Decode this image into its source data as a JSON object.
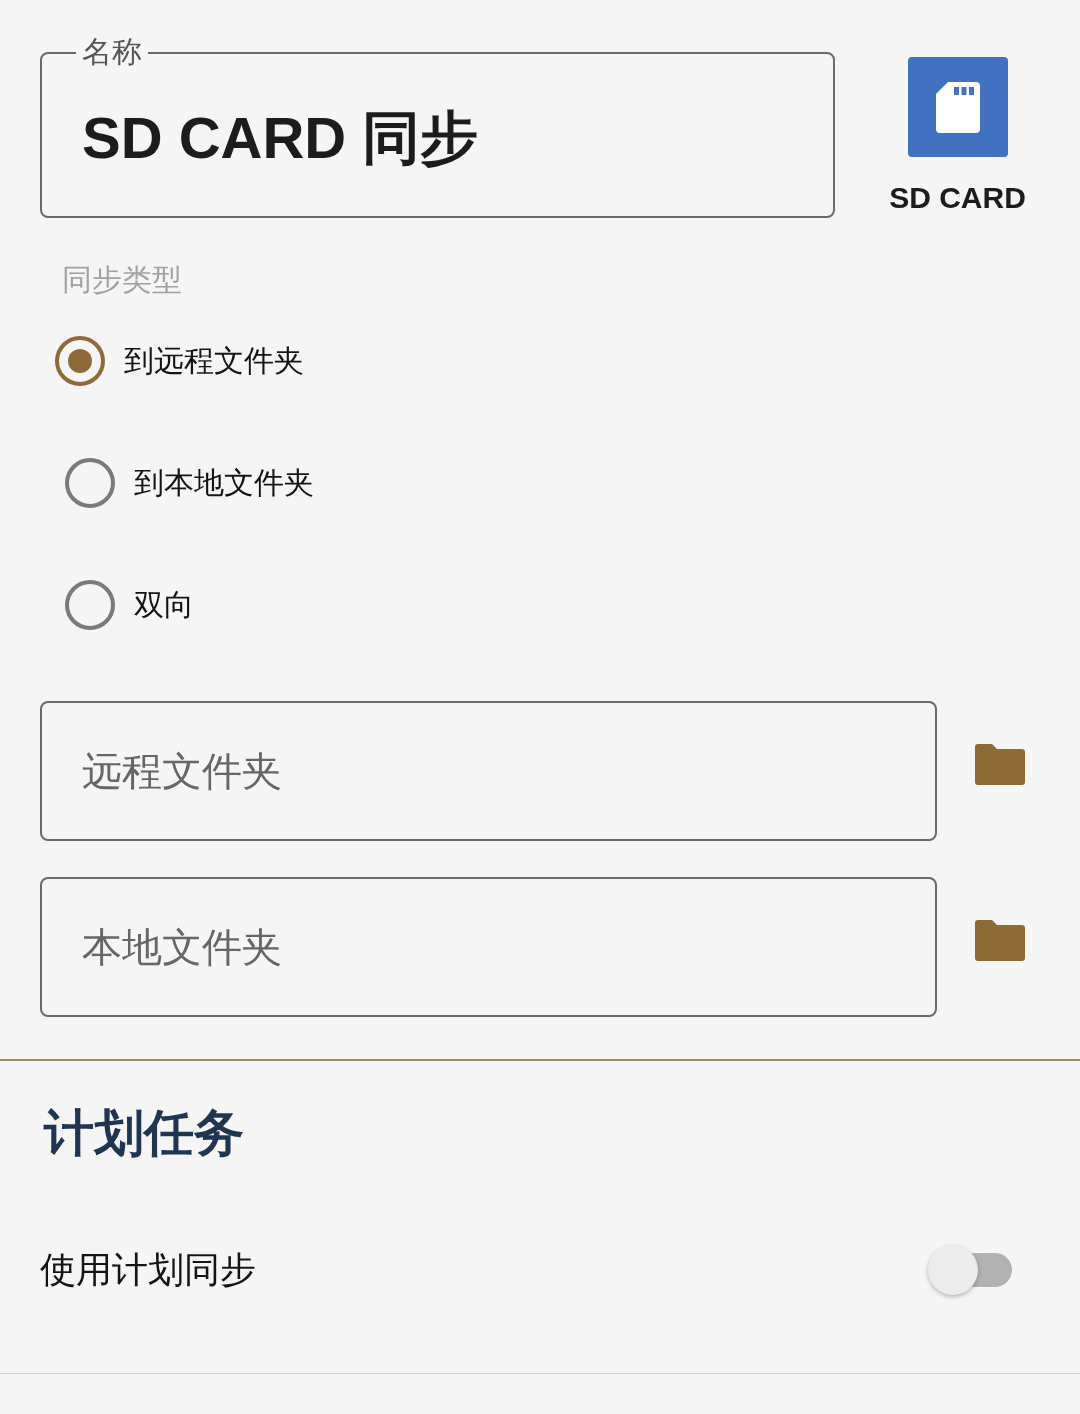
{
  "name_field": {
    "label": "名称",
    "value": "SD CARD 同步"
  },
  "source": {
    "label": "SD CARD"
  },
  "sync_type": {
    "label": "同步类型",
    "options": [
      {
        "label": "到远程文件夹",
        "selected": true
      },
      {
        "label": "到本地文件夹",
        "selected": false
      },
      {
        "label": "双向",
        "selected": false
      }
    ]
  },
  "folders": [
    {
      "placeholder": "远程文件夹"
    },
    {
      "placeholder": "本地文件夹"
    }
  ],
  "schedule": {
    "title": "计划任务",
    "label": "使用计划同步",
    "on": false
  }
}
